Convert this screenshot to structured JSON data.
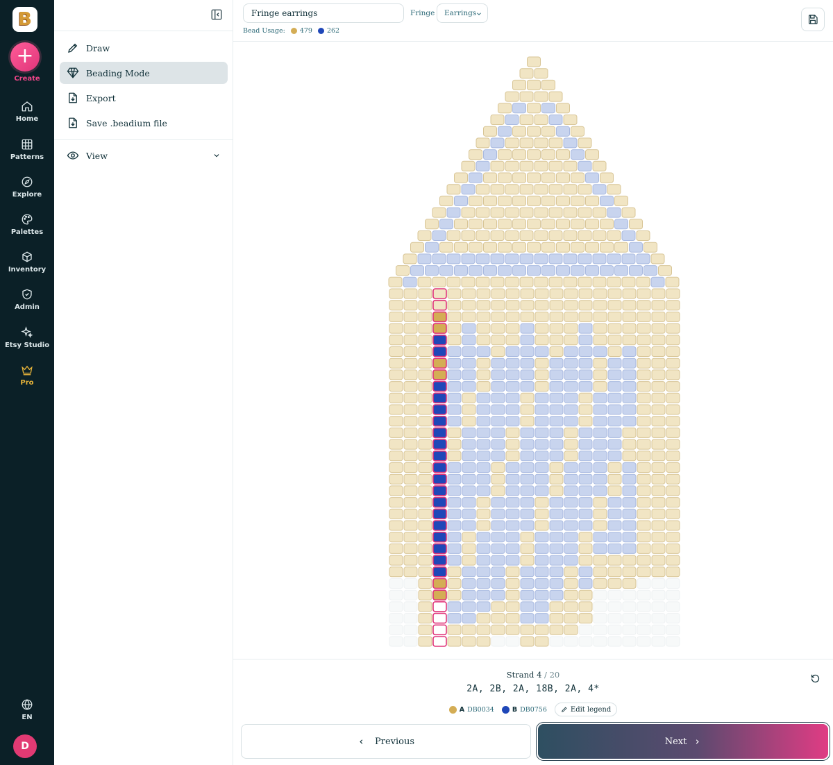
{
  "app": {
    "logo_letter": "B"
  },
  "rail": {
    "create_label": "Create",
    "items": [
      {
        "label": "Home",
        "icon": "home-icon"
      },
      {
        "label": "Patterns",
        "icon": "grid-icon"
      },
      {
        "label": "Explore",
        "icon": "compass-icon"
      },
      {
        "label": "Palettes",
        "icon": "palette-icon"
      },
      {
        "label": "Inventory",
        "icon": "box-icon"
      },
      {
        "label": "Admin",
        "icon": "shield-icon"
      },
      {
        "label": "Etsy Studio",
        "icon": "sparkles-icon"
      },
      {
        "label": "Pro",
        "icon": "crown-icon"
      }
    ],
    "language": "EN",
    "avatar_letter": "D"
  },
  "sidebar": {
    "menu": [
      {
        "label": "Draw",
        "icon": "pencil-icon",
        "active": false
      },
      {
        "label": "Beading Mode",
        "icon": "gem-icon",
        "active": true
      },
      {
        "label": "Export",
        "icon": "file-export-icon",
        "active": false
      },
      {
        "label": "Save .beadium file",
        "icon": "file-save-icon",
        "active": false
      }
    ],
    "view_label": "View"
  },
  "header": {
    "pattern_name": "Fringe earrings",
    "type_label": "Fringe",
    "type_value": "Earrings",
    "usage_label": "Bead Usage:",
    "usage": [
      {
        "count": "479",
        "color": "#d4ad55"
      },
      {
        "count": "262",
        "color": "#1f47b8"
      }
    ]
  },
  "colors": {
    "bead_a": "#f1e5c4",
    "bead_a_border": "#d8c596",
    "bead_b": "#c8d4ee",
    "bead_b_border": "#a8b9e0",
    "active_a": "#d4ad55",
    "active_b": "#1f47b8",
    "active_outline": "#e0357a",
    "empty": "#f7f9f9"
  },
  "strand": {
    "label": "Strand",
    "current": "4",
    "total": "/ 20",
    "sequence": "2A, 2B, 2A, 18B, 2A, 4*"
  },
  "legend": {
    "items": [
      {
        "key": "A",
        "code": "DB0034",
        "color": "#d4ad55"
      },
      {
        "key": "B",
        "code": "DB0756",
        "color": "#1f47b8"
      }
    ],
    "edit_label": "Edit legend"
  },
  "footer": {
    "previous_label": "Previous",
    "next_label": "Next"
  }
}
